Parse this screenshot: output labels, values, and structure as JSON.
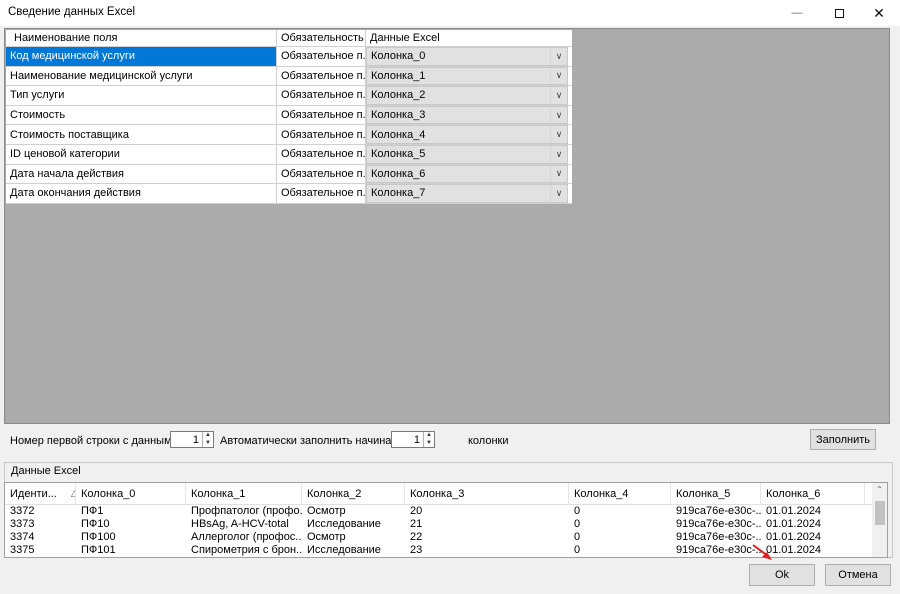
{
  "window": {
    "title": "Сведение данных Excel",
    "controls": {
      "minimize": "—",
      "close": "✕"
    }
  },
  "mapping_grid": {
    "headers": [
      "Наименование поля",
      "Обязательность",
      "Данные Excel"
    ],
    "rows": [
      {
        "field": "Код медицинской услуги",
        "required": "Обязательное п...",
        "column": "Колонка_0"
      },
      {
        "field": "Наименование медицинской услуги",
        "required": "Обязательное п...",
        "column": "Колонка_1"
      },
      {
        "field": "Тип услуги",
        "required": "Обязательное п...",
        "column": "Колонка_2"
      },
      {
        "field": "Стоимость",
        "required": "Обязательное п...",
        "column": "Колонка_3"
      },
      {
        "field": "Стоимость поставщика",
        "required": "Обязательное п...",
        "column": "Колонка_4"
      },
      {
        "field": "ID ценовой категории",
        "required": "Обязательное п...",
        "column": "Колонка_5"
      },
      {
        "field": "Дата начала действия",
        "required": "Обязательное п...",
        "column": "Колонка_6"
      },
      {
        "field": "Дата окончания действия",
        "required": "Обязательное п...",
        "column": "Колонка_7"
      }
    ],
    "selected_row": 0,
    "selection_color": "#0078d7",
    "background_color": "#ababab"
  },
  "controls": {
    "first_row_label": "Номер первой строки с данными",
    "first_row_value": "1",
    "autofill_label": "Автоматически заполнить начиная с",
    "autofill_value": "1",
    "columns_label": "колонки",
    "fill_button": "Заполнить"
  },
  "excel_data": {
    "group_label": "Данные Excel",
    "headers": [
      "Иденти...",
      "Колонка_0",
      "Колонка_1",
      "Колонка_2",
      "Колонка_3",
      "Колонка_4",
      "Колонка_5",
      "Колонка_6"
    ],
    "rows": [
      [
        "3372",
        "ПФ1",
        "Профпатолог (профо...",
        "Осмотр",
        "20",
        "0",
        "919ca76e-e30c-...",
        "01.01.2024"
      ],
      [
        "3373",
        "ПФ10",
        "HBsAg, A-HCV-total",
        "Исследование",
        "21",
        "0",
        "919ca76e-e30c-...",
        "01.01.2024"
      ],
      [
        "3374",
        "ПФ100",
        "Аллерголог (профос...",
        "Осмотр",
        "22",
        "0",
        "919ca76e-e30c-...",
        "01.01.2024"
      ],
      [
        "3375",
        "ПФ101",
        "Спирометрия с брон...",
        "Исследование",
        "23",
        "0",
        "919ca76e-e30c-...",
        "01.01.2024"
      ]
    ]
  },
  "footer": {
    "ok_button": "Ok",
    "cancel_button": "Отмена"
  },
  "icons": {
    "sort": "sort-ascending-icon",
    "dropdown": "chevron-down-icon",
    "pointer": "red-arrow-pointer-icon"
  },
  "pointer_color": "#e02020"
}
